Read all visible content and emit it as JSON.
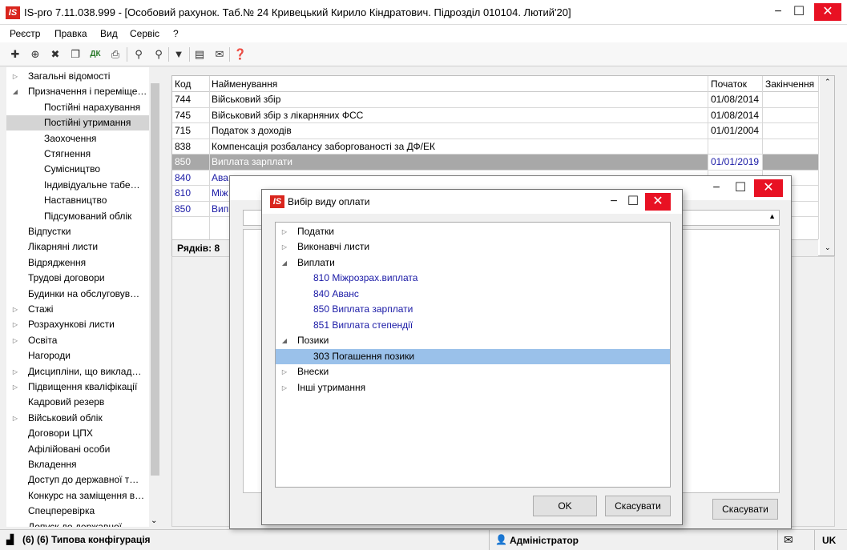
{
  "window": {
    "logo": "IS",
    "title": "IS-pro 7.11.038.999 - [Особовий рахунок. Таб.№ 24 Кривецький Кирило Кіндратович. Підрозділ 010104. Лютий'20]",
    "minimize": "−",
    "maximize": "☐",
    "close": "✕"
  },
  "menu": [
    "Реєстр",
    "Правка",
    "Вид",
    "Сервіс",
    "?"
  ],
  "toolbar_icons": [
    "new-icon",
    "new-child-icon",
    "delete-icon",
    "copy-icon",
    "dk-icon",
    "print-icon",
    "find-icon",
    "find-next-icon",
    "filter-icon",
    "doc-icon",
    "mail-icon",
    "help-icon"
  ],
  "tree": [
    {
      "label": "Загальні відомості",
      "exp": "▷",
      "level": 0
    },
    {
      "label": "Призначення і переміще…",
      "exp": "◢",
      "level": 0
    },
    {
      "label": "Постійні нарахування",
      "exp": "",
      "level": 1
    },
    {
      "label": "Постійні утримання",
      "exp": "",
      "level": 1,
      "selected": true
    },
    {
      "label": "Заохочення",
      "exp": "",
      "level": 1
    },
    {
      "label": "Стягнення",
      "exp": "",
      "level": 1
    },
    {
      "label": "Сумісництво",
      "exp": "",
      "level": 1
    },
    {
      "label": "Індивідуальне табе…",
      "exp": "",
      "level": 1
    },
    {
      "label": "Наставництво",
      "exp": "",
      "level": 1
    },
    {
      "label": "Підсумований облік",
      "exp": "",
      "level": 1
    },
    {
      "label": "Відпустки",
      "exp": "",
      "level": 0
    },
    {
      "label": "Лікарняні листи",
      "exp": "",
      "level": 0
    },
    {
      "label": "Відрядження",
      "exp": "",
      "level": 0
    },
    {
      "label": "Трудові договори",
      "exp": "",
      "level": 0
    },
    {
      "label": "Будинки на обслуговув…",
      "exp": "",
      "level": 0
    },
    {
      "label": "Стажі",
      "exp": "▷",
      "level": 0
    },
    {
      "label": "Розрахункові листи",
      "exp": "▷",
      "level": 0
    },
    {
      "label": "Освіта",
      "exp": "▷",
      "level": 0
    },
    {
      "label": "Нагороди",
      "exp": "",
      "level": 0
    },
    {
      "label": "Дисципліни, що виклад…",
      "exp": "▷",
      "level": 0
    },
    {
      "label": "Підвищення кваліфікації",
      "exp": "▷",
      "level": 0
    },
    {
      "label": "Кадровий резерв",
      "exp": "",
      "level": 0
    },
    {
      "label": "Військовий облік",
      "exp": "▷",
      "level": 0
    },
    {
      "label": "Договори ЦПХ",
      "exp": "",
      "level": 0
    },
    {
      "label": "Афілійовані особи",
      "exp": "",
      "level": 0
    },
    {
      "label": "Вкладення",
      "exp": "",
      "level": 0
    },
    {
      "label": "Доступ до державної т…",
      "exp": "",
      "level": 0
    },
    {
      "label": "Конкурс на заміщення в…",
      "exp": "",
      "level": 0
    },
    {
      "label": "Спецперевірка",
      "exp": "",
      "level": 0
    },
    {
      "label": "Допуск до державної…",
      "exp": "",
      "level": 0
    }
  ],
  "grid": {
    "headers": {
      "code": "Код",
      "name": "Найменування",
      "start": "Початок",
      "end": "Закінчення"
    },
    "rows": [
      {
        "code": "744",
        "name": "Військовий збір",
        "start": "01/08/2014",
        "end": ""
      },
      {
        "code": "745",
        "name": "Військовий збір з лікарняних ФСС",
        "start": "01/08/2014",
        "end": ""
      },
      {
        "code": "715",
        "name": "Податок з доходів",
        "start": "01/01/2004",
        "end": ""
      },
      {
        "code": "838",
        "name": "Компенсація розбалансу заборгованості за ДФ/ЕК",
        "start": "",
        "end": ""
      },
      {
        "code": "850",
        "name": "Виплата зарплати",
        "start": "01/01/2019",
        "end": "",
        "selected": true
      },
      {
        "code": "840",
        "name": "Ава",
        "start": "",
        "end": "",
        "blue": true
      },
      {
        "code": "810",
        "name": "Між",
        "start": "",
        "end": "",
        "blue": true
      },
      {
        "code": "850",
        "name": "Вип",
        "start": "",
        "end": "",
        "blue": true
      }
    ],
    "footer": "Рядків: 8"
  },
  "back_dialog": {
    "cancel": "Скасувати"
  },
  "dialog": {
    "logo": "IS",
    "title": "Вибір виду оплати",
    "items": [
      {
        "label": "Податки",
        "exp": "▷",
        "level": 0
      },
      {
        "label": "Виконавчі листи",
        "exp": "▷",
        "level": 0
      },
      {
        "label": "Виплати",
        "exp": "◢",
        "level": 0
      },
      {
        "label": "810 Міжрозрах.виплата",
        "exp": "",
        "level": 1,
        "blue": true
      },
      {
        "label": "840 Аванс",
        "exp": "",
        "level": 1,
        "blue": true
      },
      {
        "label": "850 Виплата зарплати",
        "exp": "",
        "level": 1,
        "blue": true
      },
      {
        "label": "851 Виплата степендії",
        "exp": "",
        "level": 1,
        "blue": true
      },
      {
        "label": "Позики",
        "exp": "◢",
        "level": 0
      },
      {
        "label": "303 Погашення позики",
        "exp": "",
        "level": 1,
        "selected": true
      },
      {
        "label": "Внески",
        "exp": "▷",
        "level": 0
      },
      {
        "label": "Інші утримання",
        "exp": "▷",
        "level": 0
      }
    ],
    "ok": "OK",
    "cancel": "Скасувати"
  },
  "status": {
    "config": "(6) (6) Типова конфігурація",
    "user": "Адміністратор",
    "lang": "UK"
  },
  "colors": {
    "selection_blue": "#9ac1ea",
    "row_selected": "#a8a8a8",
    "link_blue": "#1a1aa6",
    "close_red": "#e81123",
    "logo_red": "#d9251d"
  }
}
